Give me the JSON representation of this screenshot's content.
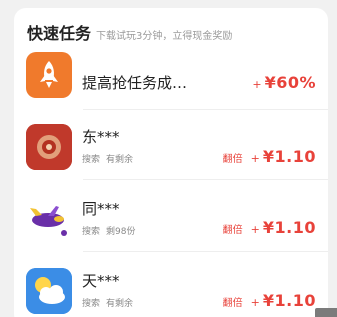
{
  "header": {
    "title": "快速任务",
    "subtitle": "下载试玩3分钟，立得现金奖励"
  },
  "tasks": [
    {
      "name": "提高抢任务成…",
      "plus": "+",
      "amount": "¥60%",
      "icon": "rocket-icon",
      "icon_bg": "#f07a2c"
    },
    {
      "name": "东***",
      "meta": [
        "搜索",
        "有剩余"
      ],
      "double": "翻倍",
      "plus": "+",
      "amount": "¥1.10",
      "icon": "app-icon-red",
      "icon_bg": "#c0392b"
    },
    {
      "name": "同***",
      "meta": [
        "搜索",
        "剩98份"
      ],
      "double": "翻倍",
      "plus": "+",
      "amount": "¥1.10",
      "icon": "airplane-icon",
      "icon_bg": "#ffffff"
    },
    {
      "name": "天***",
      "meta": [
        "搜索",
        "有剩余"
      ],
      "double": "翻倍",
      "plus": "+",
      "amount": "¥1.10",
      "icon": "weather-icon",
      "icon_bg": "#3b8de6"
    }
  ],
  "colors": {
    "accent": "#e8423a",
    "background": "#f1f1f1"
  }
}
